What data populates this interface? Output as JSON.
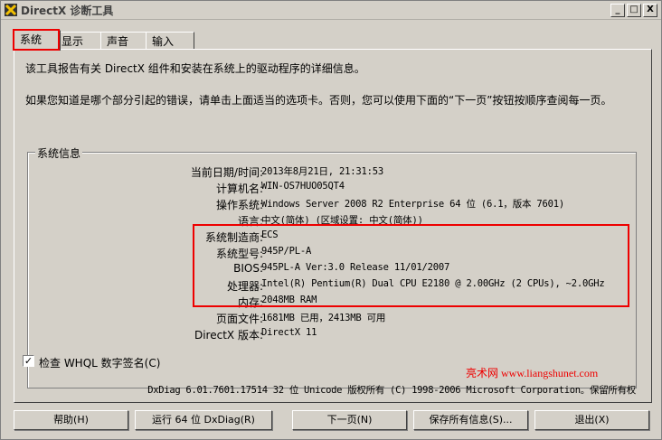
{
  "window": {
    "title": "DirectX 诊断工具",
    "minimize": "_",
    "maximize": "□",
    "close": "X"
  },
  "tabs": [
    {
      "label": "系统"
    },
    {
      "label": "显示"
    },
    {
      "label": "声音"
    },
    {
      "label": "输入"
    }
  ],
  "intro": {
    "line1": "该工具报告有关 DirectX 组件和安装在系统上的驱动程序的详细信息。",
    "line2": "如果您知道是哪个部分引起的错误，请单击上面适当的选项卡。否则，您可以使用下面的“下一页”按钮按顺序查阅每一页。"
  },
  "system_info": {
    "legend": "系统信息",
    "rows": [
      {
        "label": "当前日期/时间:",
        "value": "2013年8月21日, 21:31:53"
      },
      {
        "label": "计算机名:",
        "value": "WIN-OS7HUO05QT4"
      },
      {
        "label": "操作系统:",
        "value": "Windows Server 2008 R2 Enterprise 64 位 (6.1，版本 7601)"
      },
      {
        "label": "语言:",
        "value": "中文(简体) (区域设置: 中文(简体))"
      },
      {
        "label": "系统制造商:",
        "value": "ECS"
      },
      {
        "label": "系统型号:",
        "value": "945P/PL-A"
      },
      {
        "label": "BIOS:",
        "value": "945PL-A Ver:3.0 Release 11/01/2007"
      },
      {
        "label": "处理器:",
        "value": "Intel(R) Pentium(R) Dual  CPU  E2180  @ 2.00GHz (2 CPUs), ~2.0GHz"
      },
      {
        "label": "内存:",
        "value": "2048MB RAM"
      },
      {
        "label": "页面文件:",
        "value": "1681MB 已用，2413MB 可用"
      },
      {
        "label": "DirectX 版本:",
        "value": "DirectX 11"
      }
    ]
  },
  "whql": {
    "label": "检查 WHQL 数字签名(C)",
    "checked": "✓"
  },
  "watermark": "亮术网 www.liangshunet.com",
  "footer": "DxDiag 6.01.7601.17514 32 位 Unicode 版权所有 (C) 1998-2006 Microsoft Corporation。保留所有权",
  "buttons": {
    "help": "帮助(H)",
    "run64": "运行 64 位 DxDiag(R)",
    "next": "下一页(N)",
    "save": "保存所有信息(S)...",
    "exit": "退出(X)"
  },
  "colors": {
    "highlight_box": "#e00000",
    "face": "#d4d0c8"
  }
}
